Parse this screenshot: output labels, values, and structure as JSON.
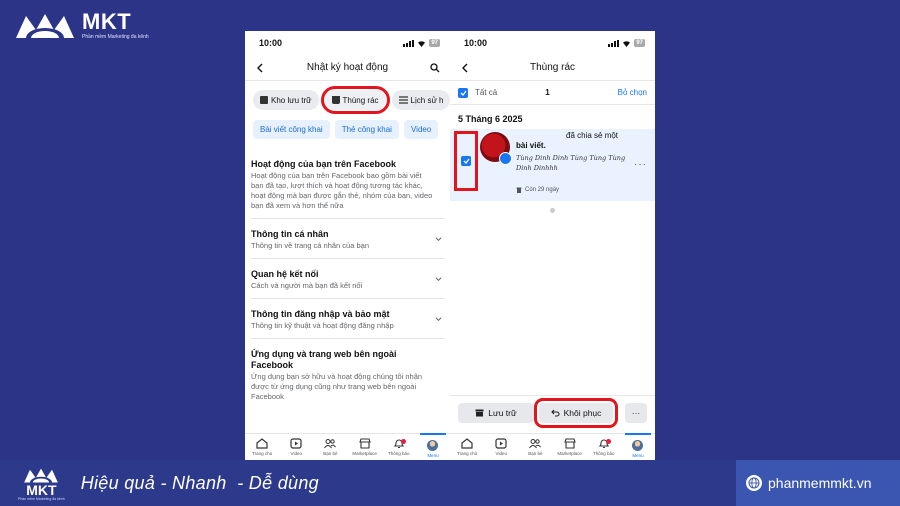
{
  "brand": {
    "name": "MKT",
    "tagline": "Phần mềm Marketing đa kênh",
    "color": "#ffffff"
  },
  "left_phone": {
    "status_time": "10:00",
    "battery": "97",
    "title": "Nhật ký hoạt động",
    "chips": [
      {
        "label": "Kho lưu trữ",
        "icon": "archive-icon"
      },
      {
        "label": "Thùng rác",
        "icon": "trash-icon",
        "highlighted": true
      },
      {
        "label": "Lịch sử h",
        "icon": "list-icon"
      }
    ],
    "filters": [
      "Bài viết công khai",
      "Thẻ công khai",
      "Video"
    ],
    "sections": [
      {
        "title": "Hoạt động của bạn trên Facebook",
        "desc": "Hoạt động của bạn trên Facebook bao gồm bài viết bạn đã tạo, lượt thích và hoạt động tương tác khác, hoạt động mà bạn được gắn thẻ, nhóm của bạn, video bạn đã xem và hơn thế nữa"
      },
      {
        "title": "Thông tin cá nhân",
        "desc": "Thông tin về trang cá nhân của bạn"
      },
      {
        "title": "Quan hệ kết nối",
        "desc": "Cách và người mà bạn đã kết nối"
      },
      {
        "title": "Thông tin đăng nhập và bảo mật",
        "desc": "Thông tin kỹ thuật và hoạt động đăng nhập"
      },
      {
        "title": "Ứng dụng và trang web bên ngoài Facebook",
        "desc": "Ứng dụng bạn sở hữu và hoạt động chúng tôi nhận được từ ứng dụng cũng như trang web bên ngoài Facebook"
      }
    ]
  },
  "right_phone": {
    "status_time": "10:00",
    "battery": "97",
    "title": "Thùng rác",
    "select_all_label": "Tất cả",
    "selected_count": "1",
    "deselect_label": "Bỏ chọn",
    "date_heading": "5 Tháng 6 2025",
    "item": {
      "text": "đã chia sẻ một",
      "text_bold": "bài viết.",
      "sub": "Tùng Dinh Dinh Tùng Tùng Tùng Dinh Dinhhh",
      "days_left": "Còn 29 ngày"
    },
    "actions": {
      "archive": "Lưu trữ",
      "restore": "Khôi phục",
      "more": "···"
    }
  },
  "tabbar": [
    {
      "label": "Trang chủ",
      "icon": "home-icon"
    },
    {
      "label": "Video",
      "icon": "video-icon"
    },
    {
      "label": "Bạn bè",
      "icon": "friends-icon"
    },
    {
      "label": "Marketplace",
      "icon": "marketplace-icon"
    },
    {
      "label": "Thông báo",
      "icon": "bell-icon",
      "badge": true
    },
    {
      "label": "Menu",
      "icon": "avatar-icon",
      "active": true
    }
  ],
  "footer": {
    "logo_name": "MKT",
    "logo_sub": "Phần mềm Marketing đa kênh",
    "slogan": "Hiệu quả - Nhanh  - Dễ dùng",
    "website": "phanmemmkt.vn"
  },
  "colors": {
    "background": "#2b3487",
    "accent": "#1877f2",
    "highlight": "#e3141b"
  }
}
